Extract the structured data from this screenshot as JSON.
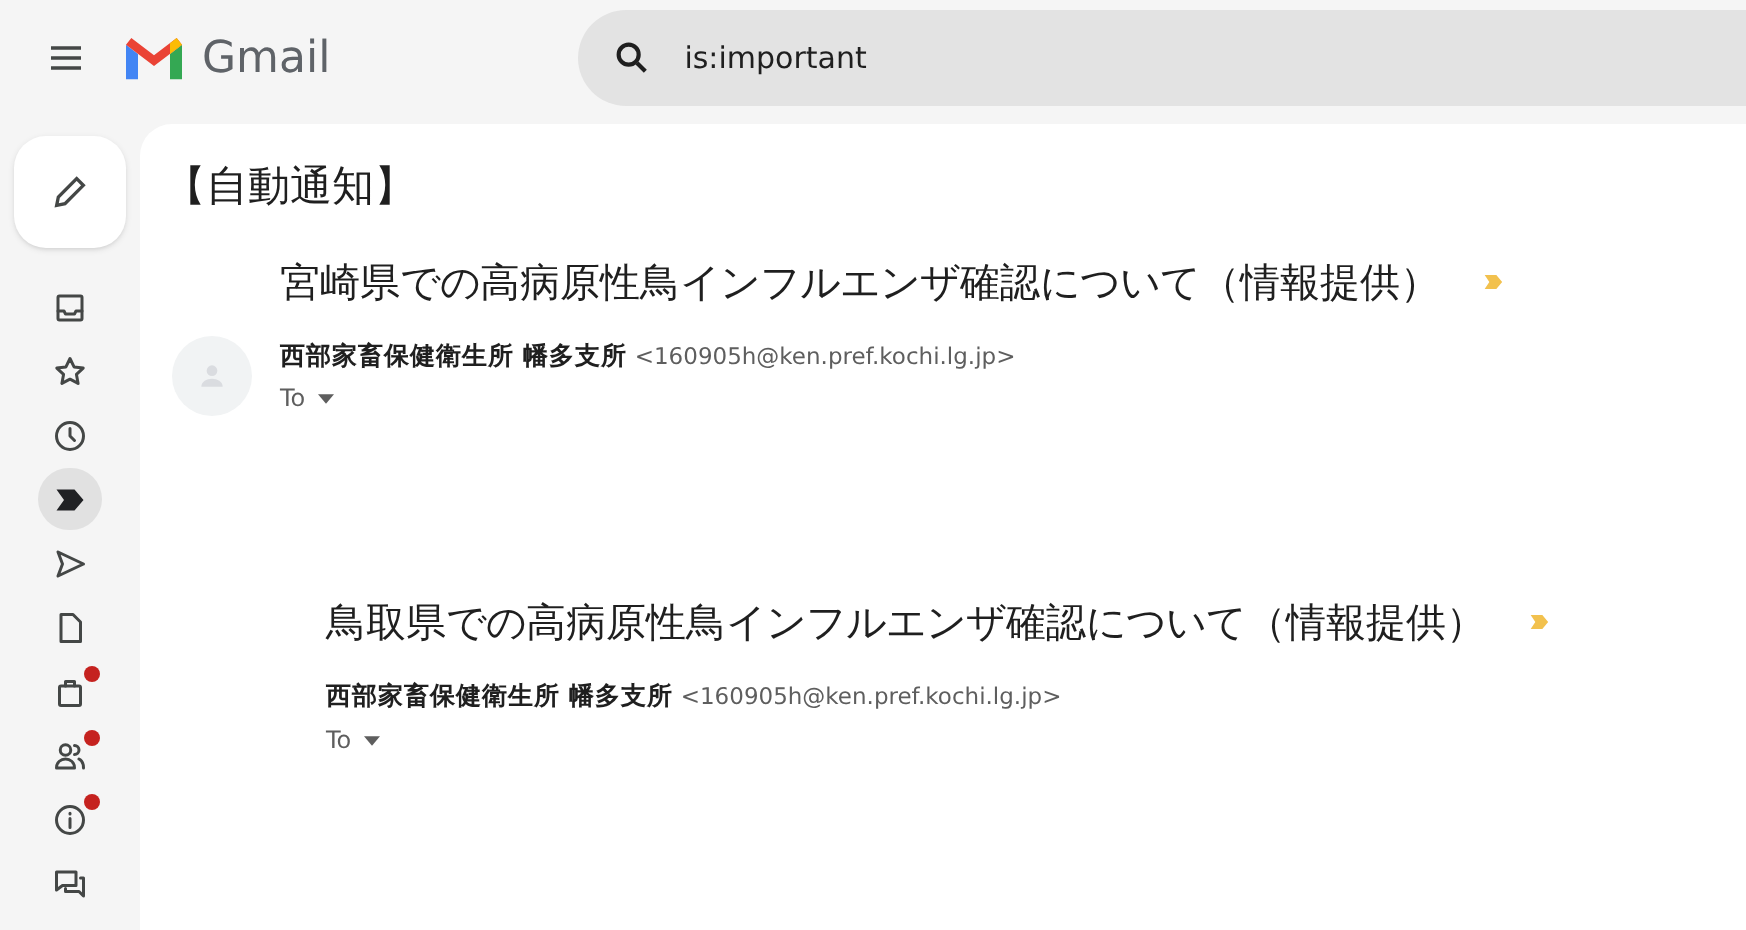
{
  "header": {
    "app_name": "Gmail",
    "search": {
      "value": "is:important"
    }
  },
  "nav": [
    {
      "kind": "inbox",
      "selected": false,
      "badge": false
    },
    {
      "kind": "star",
      "selected": false,
      "badge": false
    },
    {
      "kind": "clock",
      "selected": false,
      "badge": false
    },
    {
      "kind": "important",
      "selected": true,
      "badge": false
    },
    {
      "kind": "send",
      "selected": false,
      "badge": false
    },
    {
      "kind": "file",
      "selected": false,
      "badge": false
    },
    {
      "kind": "bag",
      "selected": false,
      "badge": true
    },
    {
      "kind": "people",
      "selected": false,
      "badge": true
    },
    {
      "kind": "info",
      "selected": false,
      "badge": true
    },
    {
      "kind": "chat",
      "selected": false,
      "badge": false
    }
  ],
  "page_title": "【自動通知】",
  "messages": [
    {
      "subject": "宮崎県での高病原性鳥インフルエンザ確認について（情報提供）",
      "important": true,
      "avatar": true,
      "sender": "西部家畜保健衛生所 幡多支所",
      "email": "<160905h@ken.pref.kochi.lg.jp>",
      "to": "To"
    },
    {
      "subject": "鳥取県での高病原性鳥インフルエンザ確認について（情報提供）",
      "important": true,
      "avatar": false,
      "sender": "西部家畜保健衛生所 幡多支所",
      "email": "<160905h@ken.pref.kochi.lg.jp>",
      "to": "To"
    }
  ]
}
